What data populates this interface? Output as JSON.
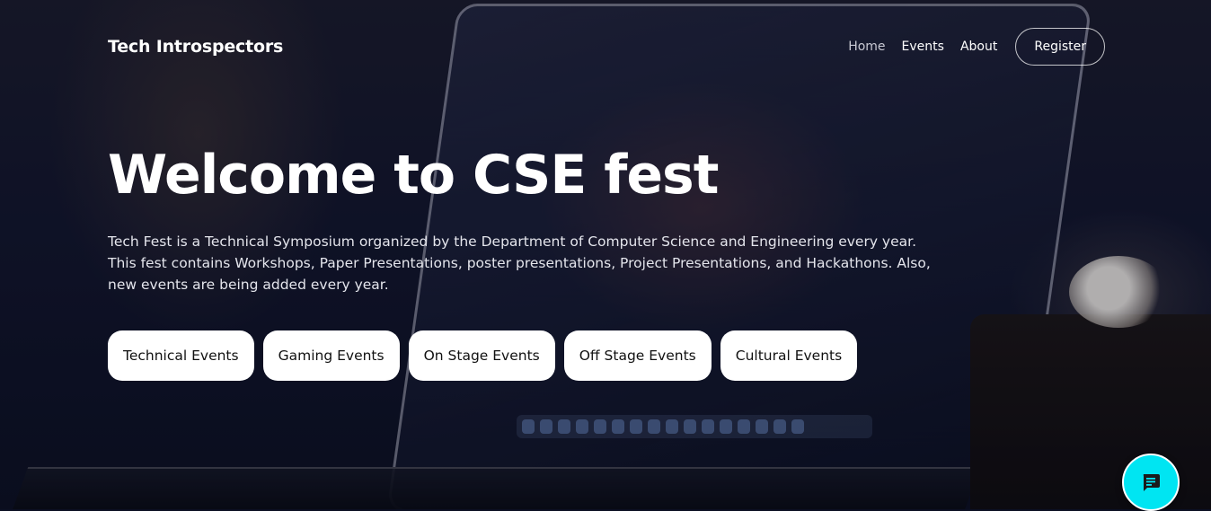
{
  "nav": {
    "brand": "Tech Introspectors",
    "links": [
      "Home",
      "Events",
      "About"
    ],
    "register_label": "Register"
  },
  "hero": {
    "title": "Welcome to CSE fest",
    "description": "Tech Fest is a Technical Symposium organized by the Department of Computer Science and Engineering every year. This fest contains Workshops, Paper Presentations, poster presentations, Project Presentations, and Hackathons. Also, new events are being added every year."
  },
  "events": [
    "Technical Events",
    "Gaming Events",
    "On Stage Events",
    "Off Stage Events",
    "Cultural Events"
  ],
  "chat": {
    "icon": "chat-bubble-icon",
    "color": "#00e5f2"
  },
  "colors": {
    "button_bg": "#ffffff",
    "button_text": "#111111",
    "accent": "#00e5f2"
  }
}
